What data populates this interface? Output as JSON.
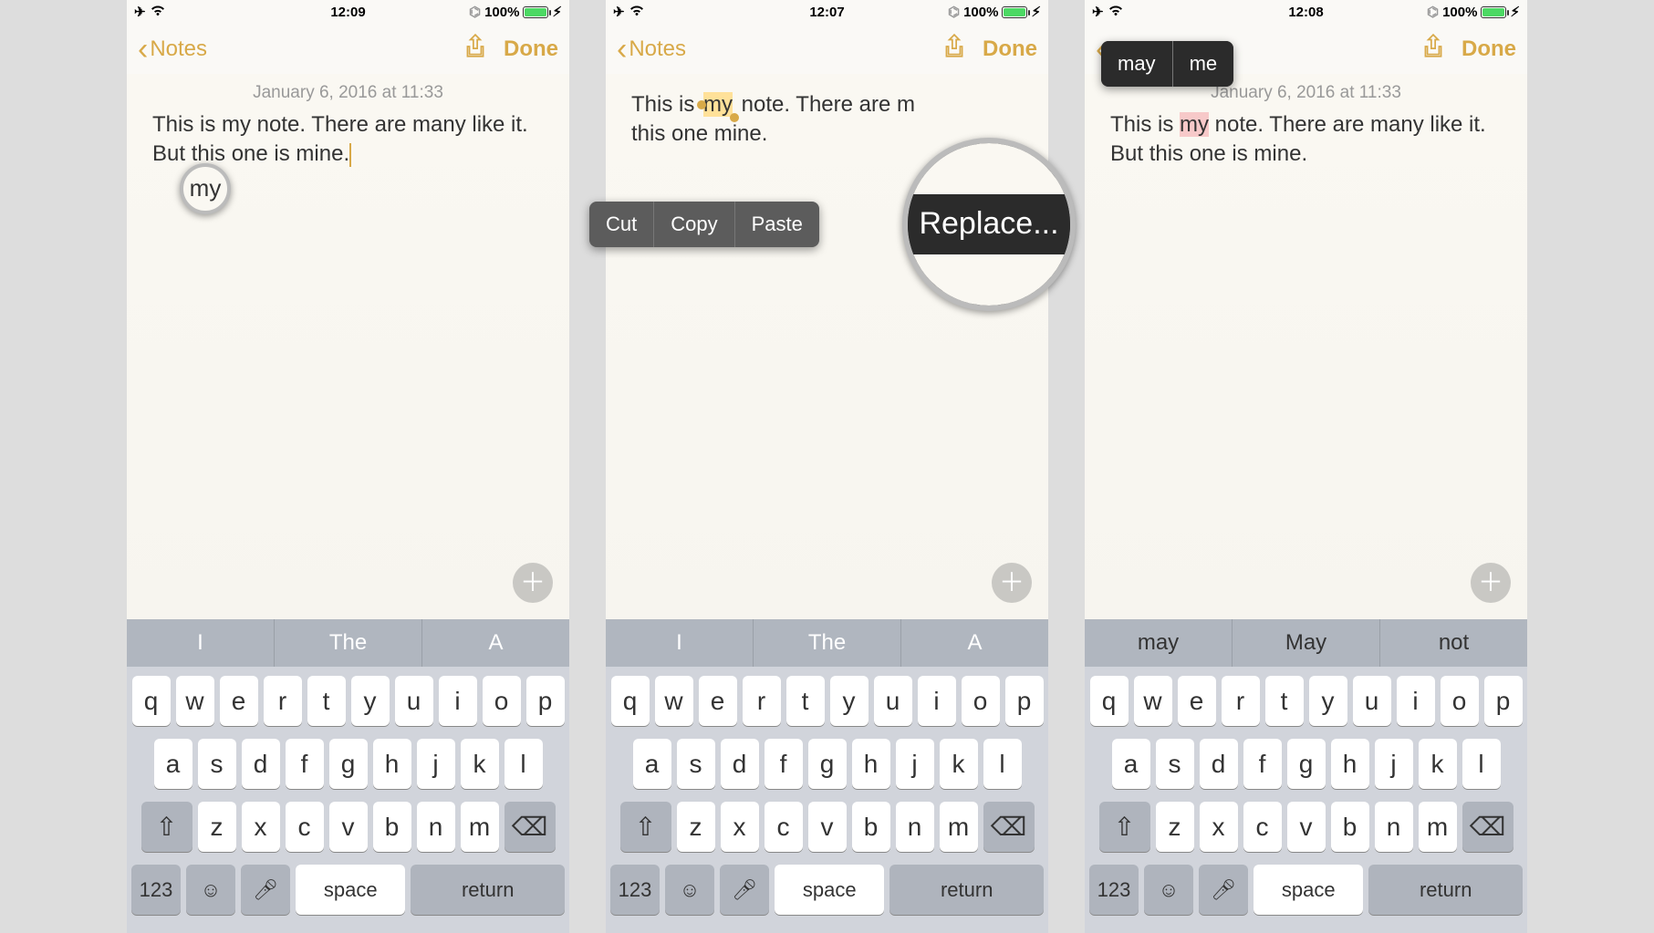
{
  "status": {
    "time1": "12:09",
    "time2": "12:07",
    "time3": "12:08",
    "battery": "100%"
  },
  "nav": {
    "back": "Notes",
    "done": "Done"
  },
  "note": {
    "timestamp": "January 6, 2016 at 11:33",
    "pre": "This is ",
    "word": "my",
    "post": " note. There are many like it. But this one is mine.",
    "post_short_a": " note. There are m",
    "post_short_b": "this one ",
    "post_short_c": " mine."
  },
  "menu": {
    "cut": "Cut",
    "copy": "Copy",
    "paste": "Paste",
    "replace": "Replace..."
  },
  "replace_popup": {
    "opt1": "may",
    "opt2": "me"
  },
  "suggestions": {
    "a": [
      "I",
      "The",
      "A"
    ],
    "b": [
      "may",
      "May",
      "not"
    ]
  },
  "keys": {
    "row1": [
      "q",
      "w",
      "e",
      "r",
      "t",
      "y",
      "u",
      "i",
      "o",
      "p"
    ],
    "row2": [
      "a",
      "s",
      "d",
      "f",
      "g",
      "h",
      "j",
      "k",
      "l"
    ],
    "row3": [
      "z",
      "x",
      "c",
      "v",
      "b",
      "n",
      "m"
    ],
    "num": "123",
    "space": "space",
    "ret": "return"
  },
  "magnifier_word": "my"
}
